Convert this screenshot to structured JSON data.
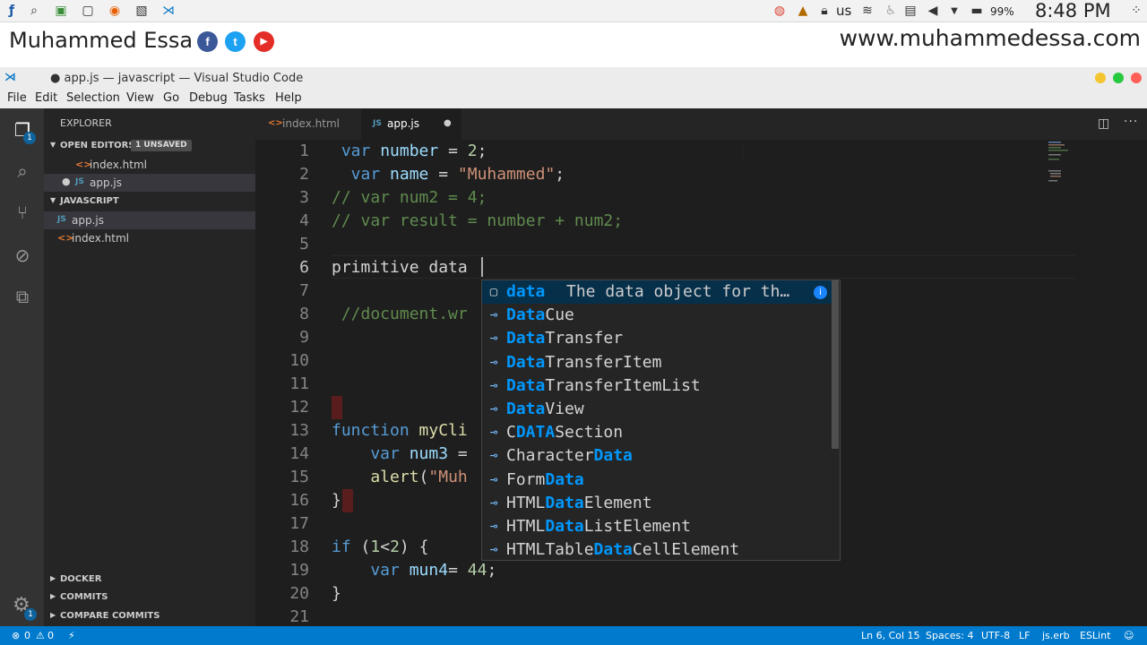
{
  "os_bar": {
    "keyboard_layout": "us",
    "battery": "99%",
    "clock": "8:48 PM"
  },
  "banner": {
    "name": "Muhammed Essa",
    "url": "www.muhammedessa.com",
    "social": [
      "f",
      "t",
      "▶"
    ]
  },
  "window": {
    "title": "● app.js — javascript — Visual Studio Code"
  },
  "menu": [
    "File",
    "Edit",
    "Selection",
    "View",
    "Go",
    "Debug",
    "Tasks",
    "Help"
  ],
  "activity_bar": {
    "explorer_badge": "1",
    "settings_badge": "1"
  },
  "sidebar": {
    "header": "EXPLORER",
    "open_editors": {
      "title": "OPEN EDITORS",
      "badge": "1 UNSAVED",
      "files": [
        {
          "icon": "<>",
          "name": "index.html"
        },
        {
          "icon": "JS",
          "name": "app.js"
        }
      ]
    },
    "folder": {
      "title": "JAVASCRIPT",
      "files": [
        {
          "icon": "JS",
          "name": "app.js"
        },
        {
          "icon": "<>",
          "name": "index.html"
        }
      ]
    },
    "bottom_sections": [
      "DOCKER",
      "COMMITS",
      "COMPARE COMMITS"
    ]
  },
  "tabs": [
    {
      "icon": "<>",
      "name": "index.html"
    },
    {
      "icon": "JS",
      "name": "app.js"
    }
  ],
  "editor": {
    "line_numbers": [
      "1",
      "2",
      "3",
      "4",
      "5",
      "6",
      "7",
      "8",
      "9",
      "10",
      "11",
      "12",
      "13",
      "14",
      "15",
      "16",
      "17",
      "18",
      "19",
      "20",
      "21"
    ],
    "lines": [
      " var number = 2;",
      "  var name = \"Muhammed\";",
      "// var num2 = 4;",
      "// var result = number + num2;",
      "",
      "primitive data",
      "",
      " //document.wr",
      "",
      "",
      "",
      "",
      "function myCli",
      "    var num3 =",
      "    alert(\"Muh",
      "}",
      "",
      "if (1<2) {",
      "    var mun4= 44;",
      "}",
      ""
    ]
  },
  "suggest": {
    "items": [
      {
        "pre": "",
        "hl": "data",
        "post": "",
        "detail": "The data object for th…",
        "kind": "field"
      },
      {
        "pre": "",
        "hl": "Data",
        "post": "Cue",
        "kind": "interface"
      },
      {
        "pre": "",
        "hl": "Data",
        "post": "Transfer",
        "kind": "interface"
      },
      {
        "pre": "",
        "hl": "Data",
        "post": "TransferItem",
        "kind": "interface"
      },
      {
        "pre": "",
        "hl": "Data",
        "post": "TransferItemList",
        "kind": "interface"
      },
      {
        "pre": "",
        "hl": "Data",
        "post": "View",
        "kind": "interface"
      },
      {
        "pre": "C",
        "hl": "DATA",
        "post": "Section",
        "kind": "interface"
      },
      {
        "pre": "Character",
        "hl": "Data",
        "post": "",
        "kind": "interface"
      },
      {
        "pre": "Form",
        "hl": "Data",
        "post": "",
        "kind": "interface"
      },
      {
        "pre": "HTML",
        "hl": "Data",
        "post": "Element",
        "kind": "interface"
      },
      {
        "pre": "HTML",
        "hl": "Data",
        "post": "ListElement",
        "kind": "interface"
      },
      {
        "pre": "HTMLTable",
        "hl": "Data",
        "post": "CellElement",
        "kind": "interface"
      }
    ]
  },
  "status": {
    "errors": "0",
    "warnings": "0",
    "position": "Ln 6, Col 15",
    "spaces": "Spaces: 4",
    "encoding": "UTF-8",
    "eol": "LF",
    "language": "js.erb",
    "linter": "ESLint"
  }
}
